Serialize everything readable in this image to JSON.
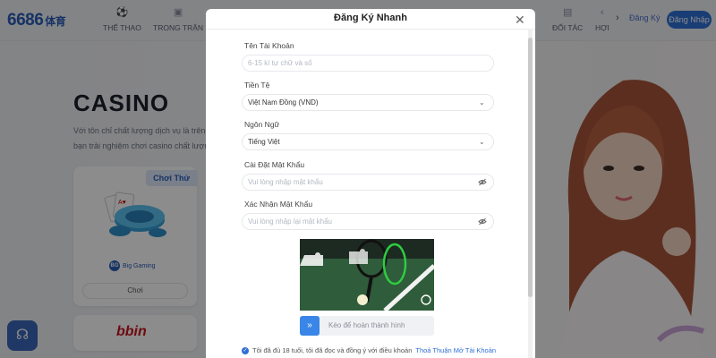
{
  "header": {
    "logo_text": "6686",
    "logo_suffix": "体育",
    "nav": [
      {
        "label": "THỂ THAO",
        "icon": "soccer-ball-icon"
      },
      {
        "label": "TRONG TRẬN",
        "icon": "video-icon"
      },
      {
        "label": "ĐỐI TÁC",
        "icon": "partner-icon"
      },
      {
        "label": "HỢI",
        "icon": "chevron-left-icon"
      }
    ],
    "register_label": "Đăng Ký",
    "login_label": "Đăng Nhập"
  },
  "hero": {
    "title": "CASINO",
    "desc_line1": "Với tôn chỉ chất lượng dịch vụ là trên h",
    "desc_line2": "bạn trải nghiệm chơi casino chất lượng"
  },
  "game_card": {
    "badge": "Chơi Thử",
    "provider": "BG",
    "provider_name": "Big Gaming",
    "play_label": "Chơi"
  },
  "provider_card_2": {
    "logo": "bbin"
  },
  "modal": {
    "title": "Đăng Ký Nhanh",
    "fields": {
      "username": {
        "label": "Tên Tài Khoản",
        "placeholder": "6-15 kí tự chữ và số"
      },
      "currency": {
        "label": "Tiền Tệ",
        "value": "Việt Nam Đồng (VND)"
      },
      "language": {
        "label": "Ngôn Ngữ",
        "value": "Tiếng Việt"
      },
      "password": {
        "label": "Cài Đặt Mật Khẩu",
        "placeholder": "Vui lòng nhập mật khẩu"
      },
      "confirm_password": {
        "label": "Xác Nhận Mật Khẩu",
        "placeholder": "Vui lòng nhập lại mật khẩu"
      }
    },
    "slider_text": "Kéo để hoàn thành hình",
    "agree_text": "Tôi đã đủ 18 tuổi, tôi đã đọc và đồng ý với điều khoản",
    "agree_link": "Thoả Thuận Mở Tài Khoản"
  },
  "colors": {
    "brand_blue": "#2f6fd6",
    "overlay": "rgba(0,0,0,0.45)"
  }
}
